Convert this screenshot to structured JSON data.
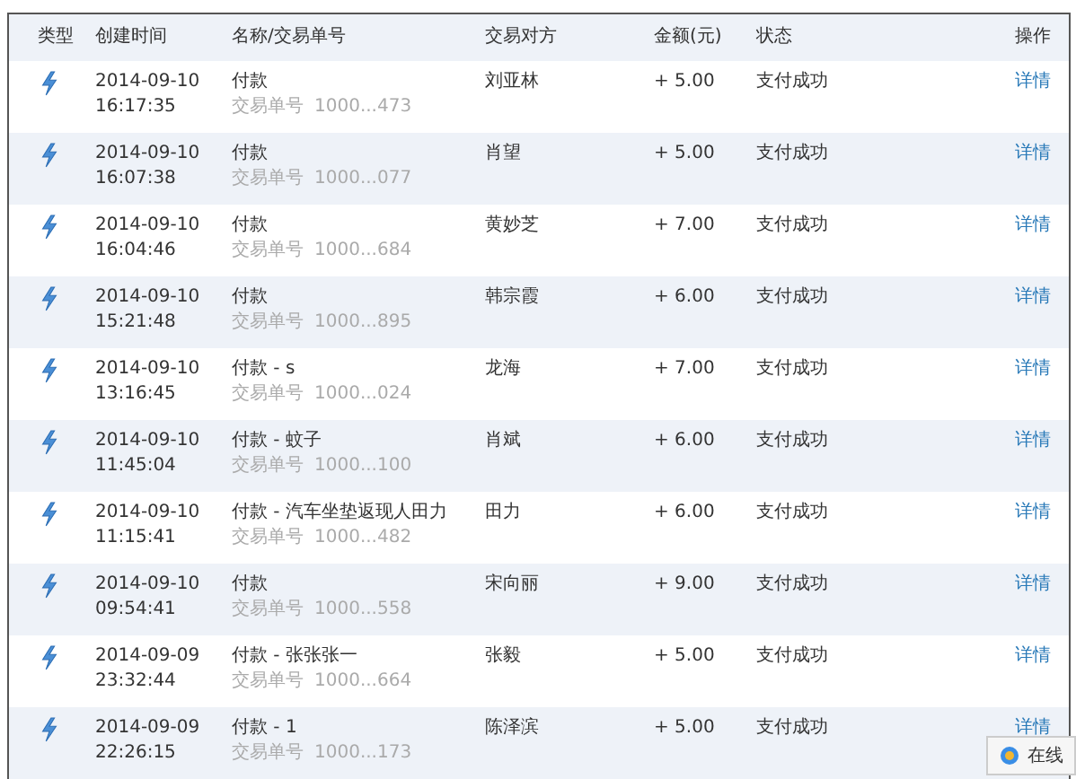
{
  "table": {
    "columns": [
      "类型",
      "创建时间",
      "名称/交易单号",
      "交易对方",
      "金额(元)",
      "状态",
      "操作"
    ],
    "rows": [
      {
        "date": "2014-09-10",
        "time": "16:17:35",
        "name": "付款",
        "order_label": "交易单号",
        "order_no": "1000...473",
        "party": "刘亚林",
        "amount": "+ 5.00",
        "status": "支付成功",
        "action": "详情"
      },
      {
        "date": "2014-09-10",
        "time": "16:07:38",
        "name": "付款",
        "order_label": "交易单号",
        "order_no": "1000...077",
        "party": "肖望",
        "amount": "+ 5.00",
        "status": "支付成功",
        "action": "详情"
      },
      {
        "date": "2014-09-10",
        "time": "16:04:46",
        "name": "付款",
        "order_label": "交易单号",
        "order_no": "1000...684",
        "party": "黄妙芝",
        "amount": "+ 7.00",
        "status": "支付成功",
        "action": "详情"
      },
      {
        "date": "2014-09-10",
        "time": "15:21:48",
        "name": "付款",
        "order_label": "交易单号",
        "order_no": "1000...895",
        "party": "韩宗霞",
        "amount": "+ 6.00",
        "status": "支付成功",
        "action": "详情"
      },
      {
        "date": "2014-09-10",
        "time": "13:16:45",
        "name": "付款 - s",
        "order_label": "交易单号",
        "order_no": "1000...024",
        "party": "龙海",
        "amount": "+ 7.00",
        "status": "支付成功",
        "action": "详情"
      },
      {
        "date": "2014-09-10",
        "time": "11:45:04",
        "name": "付款 - 蚊子",
        "order_label": "交易单号",
        "order_no": "1000...100",
        "party": "肖斌",
        "amount": "+ 6.00",
        "status": "支付成功",
        "action": "详情"
      },
      {
        "date": "2014-09-10",
        "time": "11:15:41",
        "name": "付款 - 汽车坐垫返现人田力",
        "order_label": "交易单号",
        "order_no": "1000...482",
        "party": "田力",
        "amount": "+ 6.00",
        "status": "支付成功",
        "action": "详情"
      },
      {
        "date": "2014-09-10",
        "time": "09:54:41",
        "name": "付款",
        "order_label": "交易单号",
        "order_no": "1000...558",
        "party": "宋向丽",
        "amount": "+ 9.00",
        "status": "支付成功",
        "action": "详情"
      },
      {
        "date": "2014-09-09",
        "time": "23:32:44",
        "name": "付款 - 张张张一",
        "order_label": "交易单号",
        "order_no": "1000...664",
        "party": "张毅",
        "amount": "+ 5.00",
        "status": "支付成功",
        "action": "详情"
      },
      {
        "date": "2014-09-09",
        "time": "22:26:15",
        "name": "付款 - 1",
        "order_label": "交易单号",
        "order_no": "1000...173",
        "party": "陈泽滨",
        "amount": "+ 5.00",
        "status": "支付成功",
        "action": "详情"
      }
    ]
  },
  "online_button": {
    "label": "在线"
  }
}
